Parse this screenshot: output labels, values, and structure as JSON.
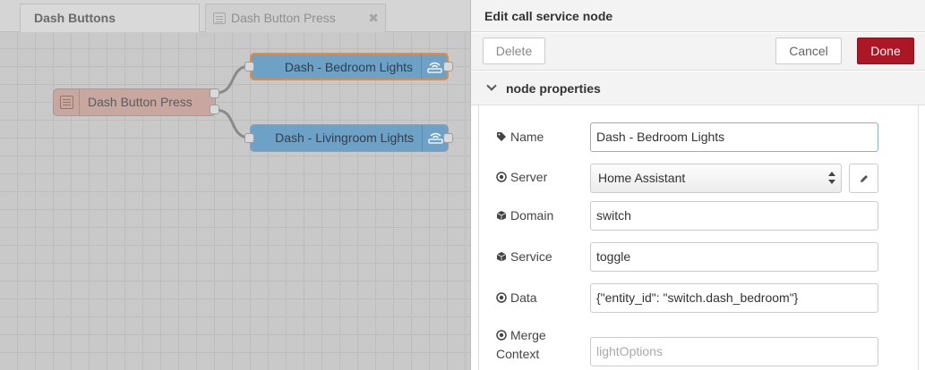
{
  "tabs": [
    {
      "label": "Dash Buttons",
      "active": true
    },
    {
      "label": "Dash Button Press",
      "active": false,
      "close_icon": "close-icon"
    }
  ],
  "flow": {
    "nodes": {
      "source": {
        "label": "Dash Button Press",
        "icon": "list-icon"
      },
      "bedroom": {
        "label": "Dash - Bedroom Lights",
        "icon": "wifi-router-icon",
        "selected": true
      },
      "livingroom": {
        "label": "Dash - Livingroom Lights",
        "icon": "wifi-router-icon"
      }
    }
  },
  "tray": {
    "title": "Edit call service node",
    "buttons": {
      "delete": "Delete",
      "cancel": "Cancel",
      "done": "Done"
    },
    "section": "node properties",
    "fields": {
      "name": {
        "label": "Name",
        "icon": "tag-icon",
        "value": "Dash - Bedroom Lights"
      },
      "server": {
        "label": "Server",
        "icon": "dot-circle-icon",
        "value": "Home Assistant"
      },
      "domain": {
        "label": "Domain",
        "icon": "cube-icon",
        "value": "switch"
      },
      "service": {
        "label": "Service",
        "icon": "cube-icon",
        "value": "toggle"
      },
      "data": {
        "label": "Data",
        "icon": "dot-circle-icon",
        "value": "{\"entity_id\": \"switch.dash_bedroom\"}"
      },
      "merge": {
        "label_line1": "Merge",
        "label_line2": "Context",
        "icon": "dot-circle-icon",
        "placeholder": "lightOptions"
      }
    }
  },
  "colors": {
    "done_button": "#ad1625",
    "node_blue": "#6da1c6",
    "node_source": "#c7a79f",
    "selected_outline": "#e78a3c"
  }
}
